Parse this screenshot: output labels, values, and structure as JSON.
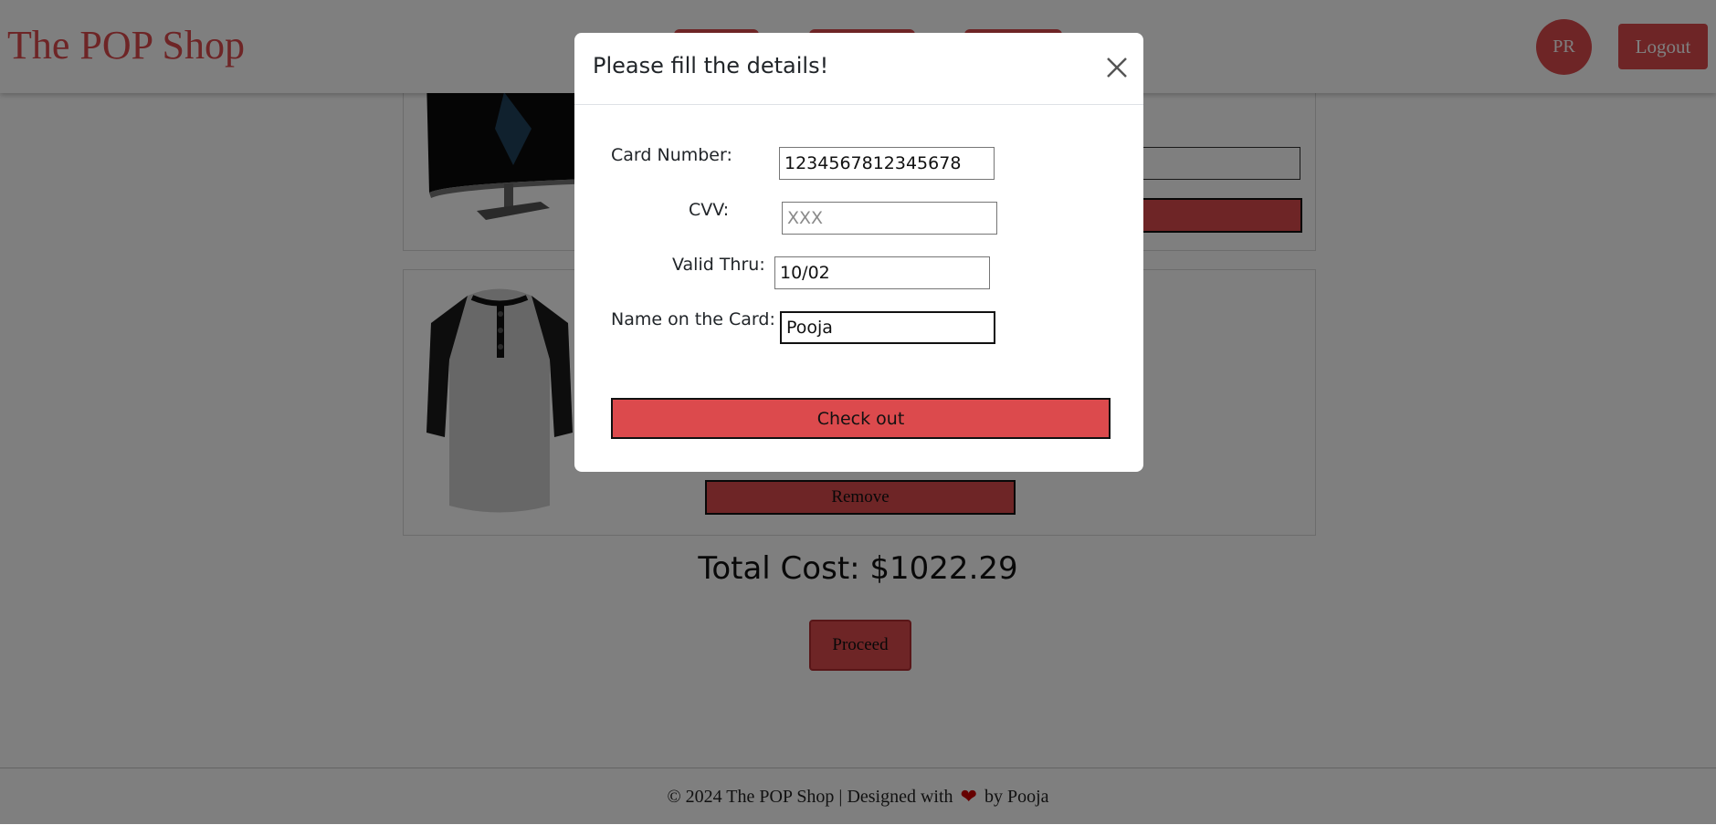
{
  "navbar": {
    "brand": "The POP Shop",
    "avatar_initials": "PR",
    "logout_label": "Logout"
  },
  "cart": {
    "items": [
      {
        "image": "monitor-image"
      },
      {
        "image": "henley-shirt-image",
        "remove_label": "Remove"
      }
    ],
    "total_label": "Total Cost: $1022.29",
    "proceed_label": "Proceed"
  },
  "footer": {
    "prefix": "© 2024 The POP Shop | Designed with",
    "heart_icon": "heart-icon",
    "suffix": "by Pooja"
  },
  "modal": {
    "title": "Please fill the details!",
    "fields": {
      "card_number": {
        "label": "Card Number:",
        "value": "1234567812345678",
        "placeholder": ""
      },
      "cvv": {
        "label": "CVV:",
        "value": "",
        "placeholder": "XXX"
      },
      "valid_thru": {
        "label": "Valid Thru:",
        "value": "10/02",
        "placeholder": ""
      },
      "name_on_card": {
        "label": "Name on the Card:",
        "value": "Pooja",
        "placeholder": ""
      }
    },
    "checkout_label": "Check out"
  },
  "colors": {
    "accent": "#dc4a4d",
    "overlay": "rgba(0,0,0,0.5)",
    "heart": "#cc0000"
  }
}
